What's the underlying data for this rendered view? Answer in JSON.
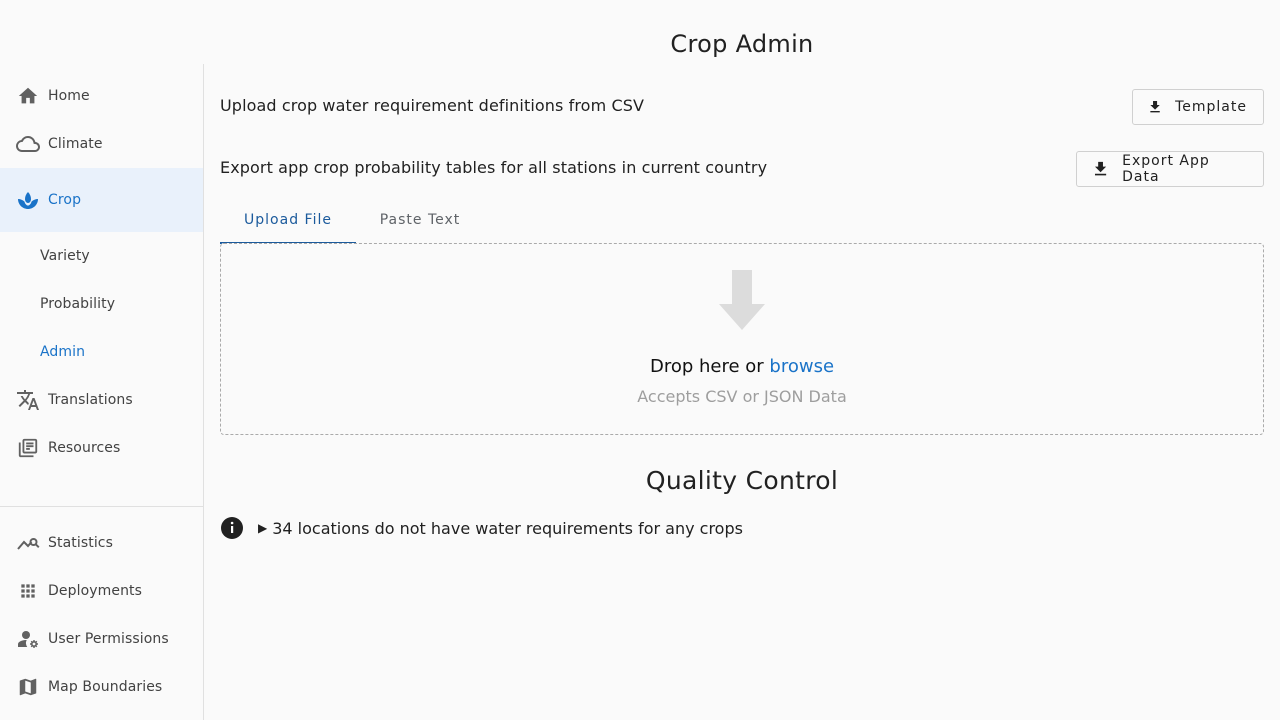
{
  "page": {
    "title": "Crop Admin"
  },
  "sidebar": {
    "items": [
      {
        "label": "Home",
        "icon": "home-icon"
      },
      {
        "label": "Climate",
        "icon": "cloud-icon"
      },
      {
        "label": "Crop",
        "icon": "sprout-icon",
        "active": true
      },
      {
        "label": "Translations",
        "icon": "translate-icon"
      },
      {
        "label": "Resources",
        "icon": "library-icon"
      }
    ],
    "subitems": [
      {
        "label": "Variety"
      },
      {
        "label": "Probability"
      },
      {
        "label": "Admin",
        "active": true
      }
    ],
    "bottom_items": [
      {
        "label": "Statistics",
        "icon": "chart-search-icon"
      },
      {
        "label": "Deployments",
        "icon": "apps-grid-icon"
      },
      {
        "label": "User Permissions",
        "icon": "user-gear-icon"
      },
      {
        "label": "Map Boundaries",
        "icon": "map-icon"
      }
    ]
  },
  "main": {
    "upload_text": "Upload crop water requirement definitions from CSV",
    "template_button": "Template",
    "export_text": "Export app crop probability tables for all stations in current country",
    "export_button": "Export App Data",
    "tabs": [
      {
        "label": "Upload File",
        "active": true
      },
      {
        "label": "Paste Text"
      }
    ],
    "dropzone": {
      "text": "Drop here or",
      "link": "browse",
      "subtext": "Accepts CSV or JSON Data"
    },
    "quality_control": {
      "title": "Quality Control",
      "items": [
        {
          "text": "34 locations do not have water requirements for any crops"
        }
      ]
    }
  },
  "colors": {
    "accent": "#1a73c8",
    "active_bg": "#e9f1fb",
    "tab_active": "#1b5a9c"
  }
}
